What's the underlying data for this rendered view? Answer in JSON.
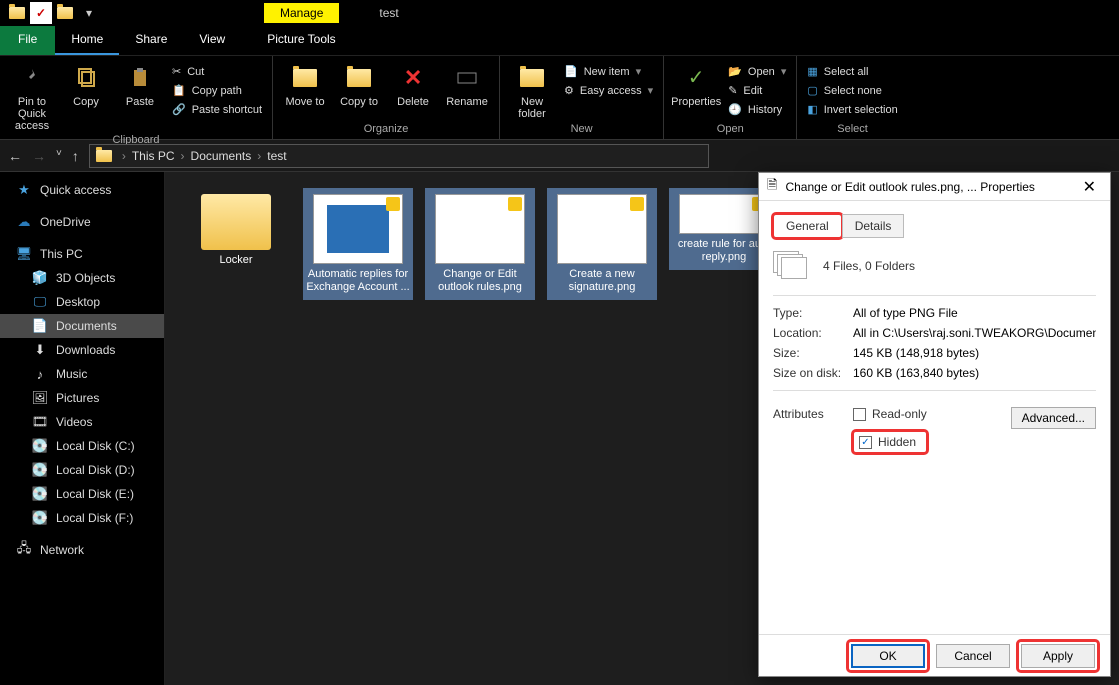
{
  "window": {
    "context_tab": "Manage",
    "title": "test"
  },
  "menu": {
    "file": "File",
    "home": "Home",
    "share": "Share",
    "view": "View",
    "picture_tools": "Picture Tools"
  },
  "ribbon": {
    "clipboard": {
      "pin": "Pin to Quick access",
      "copy": "Copy",
      "paste": "Paste",
      "cut": "Cut",
      "copy_path": "Copy path",
      "paste_shortcut": "Paste shortcut",
      "group": "Clipboard"
    },
    "organize": {
      "move": "Move to",
      "copy": "Copy to",
      "delete": "Delete",
      "rename": "Rename",
      "group": "Organize"
    },
    "new": {
      "new_folder": "New folder",
      "new_item": "New item",
      "easy_access": "Easy access",
      "group": "New"
    },
    "open": {
      "properties": "Properties",
      "open": "Open",
      "edit": "Edit",
      "history": "History",
      "group": "Open"
    },
    "select": {
      "select_all": "Select all",
      "select_none": "Select none",
      "invert": "Invert selection",
      "group": "Select"
    }
  },
  "address": {
    "this_pc": "This PC",
    "documents": "Documents",
    "current": "test"
  },
  "sidebar": {
    "quick_access": "Quick access",
    "onedrive": "OneDrive",
    "this_pc": "This PC",
    "objects3d": "3D Objects",
    "desktop": "Desktop",
    "documents": "Documents",
    "downloads": "Downloads",
    "music": "Music",
    "pictures": "Pictures",
    "videos": "Videos",
    "disk_c": "Local Disk (C:)",
    "disk_d": "Local Disk (D:)",
    "disk_e": "Local Disk (E:)",
    "disk_f": "Local Disk (F:)",
    "network": "Network"
  },
  "files": {
    "f0": "Locker",
    "f1": "Automatic replies for Exchange Account ...",
    "f2": "Change or Edit outlook rules.png",
    "f3": "Create a new signature.png",
    "f4": "create rule for auto reply.png"
  },
  "dialog": {
    "title": "Change or Edit outlook rules.png, ... Properties",
    "tab_general": "General",
    "tab_details": "Details",
    "summary": "4 Files, 0 Folders",
    "type_label": "Type:",
    "type_val": "All of type PNG File",
    "loc_label": "Location:",
    "loc_val": "All in C:\\Users\\raj.soni.TWEAKORG\\Documents\\tes",
    "size_label": "Size:",
    "size_val": "145 KB (148,918 bytes)",
    "ondisk_label": "Size on disk:",
    "ondisk_val": "160 KB (163,840 bytes)",
    "attr_label": "Attributes",
    "readonly": "Read-only",
    "hidden": "Hidden",
    "advanced": "Advanced...",
    "ok": "OK",
    "cancel": "Cancel",
    "apply": "Apply"
  }
}
